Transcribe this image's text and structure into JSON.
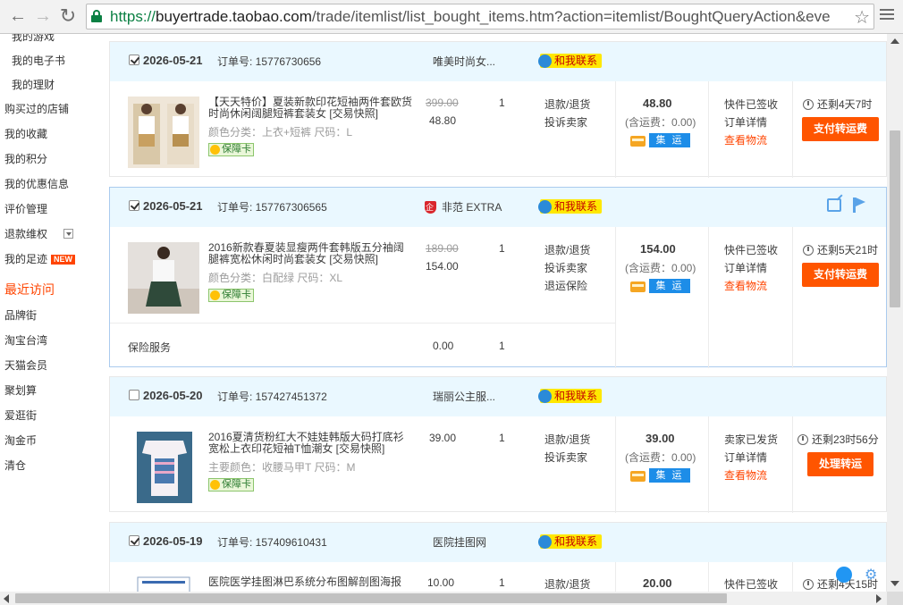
{
  "browser": {
    "url_https": "https://",
    "url_host": "buyertrade.taobao.com",
    "url_path": "/trade/itemlist/list_bought_items.htm?action=itemlist/BoughtQueryAction&eve"
  },
  "sidebar": {
    "items_top": [
      "我的游戏",
      "我的电子书",
      "我的理财"
    ],
    "items": [
      "购买过的店铺",
      "我的收藏",
      "我的积分",
      "我的优惠信息",
      "评价管理",
      "退款维权",
      "我的足迹"
    ],
    "new_badge": "NEW",
    "recent_title": "最近访问",
    "recent": [
      "品牌街",
      "淘宝台湾",
      "天猫会员",
      "聚划算",
      "爱逛街",
      "淘金币",
      "清仓"
    ]
  },
  "common": {
    "order_no_label": "订单号: ",
    "contact": "和我联系",
    "guarantee": "保障卡",
    "shipping_fee": "(含运费：0.00)",
    "jiyun": "集 运",
    "refund": "退款/退货",
    "complain": "投诉卖家",
    "order_detail": "订单详情",
    "logistics": "查看物流"
  },
  "orders": [
    {
      "checked": true,
      "date": "2026-05-21",
      "order_no": "15776730656",
      "shop": "唯美时尚女...",
      "title": "【天天特价】夏装新款印花短袖两件套欧货时尚休闲阔腿短裤套装女 [交易快照]",
      "attr": "颜色分类：上衣+短裤   尺码：L",
      "orig_price": "399.00",
      "price": "48.80",
      "qty": "1",
      "total": "48.80",
      "status": "快件已签收",
      "timer": "还剩4天7时",
      "action": "支付转运费"
    },
    {
      "checked": true,
      "date": "2026-05-21",
      "order_no": "157767306565",
      "shop": "非范 EXTRA",
      "title": "2016新款春夏装显瘦两件套韩版五分袖阔腿裤宽松休闲时尚套装女 [交易快照]",
      "attr": "颜色分类：白配绿   尺码：XL",
      "orig_price": "189.00",
      "price": "154.00",
      "qty": "1",
      "total": "154.00",
      "extra_link": "退运保险",
      "status": "快件已签收",
      "timer": "还剩5天21时",
      "action": "支付转运费",
      "service_label": "保险服务",
      "service_price": "0.00",
      "service_qty": "1"
    },
    {
      "checked": false,
      "date": "2026-05-20",
      "order_no": "157427451372",
      "shop": "瑞丽公主服...",
      "title": "2016夏清货粉红大不娃娃韩版大码打底衫宽松上衣印花短袖T恤潮女 [交易快照]",
      "attr": "主要颜色：收腰马甲T   尺码：M",
      "price": "39.00",
      "qty": "1",
      "total": "39.00",
      "status": "卖家已发货",
      "timer": "还剩23时56分",
      "action": "处理转运"
    },
    {
      "checked": true,
      "date": "2026-05-19",
      "order_no": "157409610431",
      "shop": "医院挂图网",
      "title": "医院医学挂图淋巴系统分布图解剖图海报",
      "price": "10.00",
      "qty": "1",
      "total": "20.00",
      "status": "快件已签收",
      "timer": "还剩4天15时"
    }
  ]
}
